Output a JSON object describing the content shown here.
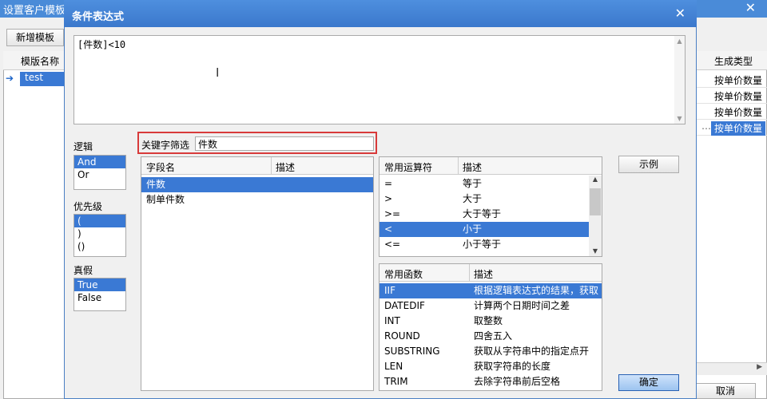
{
  "background_window": {
    "title": "设置客户模板",
    "add_template_label": "新增模板",
    "left_grid": {
      "header": "模版名称",
      "rows": [
        "test"
      ]
    },
    "right_grid": {
      "header": "生成类型",
      "rows": [
        "按单价数量",
        "按单价数量",
        "按单价数量",
        "按单价数量"
      ]
    },
    "cancel_label": "取消"
  },
  "dialog": {
    "title": "条件表达式",
    "expression": "[件数]<10",
    "logic": {
      "label": "逻辑",
      "items": [
        "And",
        "Or"
      ],
      "selected": 0
    },
    "priority": {
      "label": "优先级",
      "items": [
        "(",
        ")",
        "()"
      ],
      "selected": 0
    },
    "truth": {
      "label": "真假",
      "items": [
        "True",
        "False"
      ],
      "selected": 0
    },
    "keyword_filter": {
      "label": "关键字筛选",
      "value": "件数"
    },
    "fields": {
      "columns": [
        "字段名",
        "描述"
      ],
      "rows": [
        {
          "name": "件数",
          "desc": ""
        },
        {
          "name": "制单件数",
          "desc": ""
        }
      ],
      "selected": 0
    },
    "operators": {
      "columns": [
        "常用运算符",
        "描述"
      ],
      "rows": [
        {
          "op": "=",
          "desc": "等于"
        },
        {
          "op": ">",
          "desc": "大于"
        },
        {
          "op": ">=",
          "desc": "大于等于"
        },
        {
          "op": "<",
          "desc": "小于"
        },
        {
          "op": "<=",
          "desc": "小于等于"
        }
      ],
      "selected": 3
    },
    "functions": {
      "columns": [
        "常用函数",
        "描述"
      ],
      "rows": [
        {
          "fn": "IIF",
          "desc": "根据逻辑表达式的结果，获取"
        },
        {
          "fn": "DATEDIF",
          "desc": "计算两个日期时间之差"
        },
        {
          "fn": "INT",
          "desc": "取整数"
        },
        {
          "fn": "ROUND",
          "desc": "四舍五入"
        },
        {
          "fn": "SUBSTRING",
          "desc": "获取从字符串中的指定点开"
        },
        {
          "fn": "LEN",
          "desc": "获取字符串的长度"
        },
        {
          "fn": "TRIM",
          "desc": "去除字符串前后空格"
        }
      ],
      "selected": 0
    },
    "example_label": "示例",
    "ok_label": "确定"
  },
  "colors": {
    "title_bar": "#3b78cc",
    "selection": "#3a79d4",
    "highlight_border": "#d83a3a"
  }
}
